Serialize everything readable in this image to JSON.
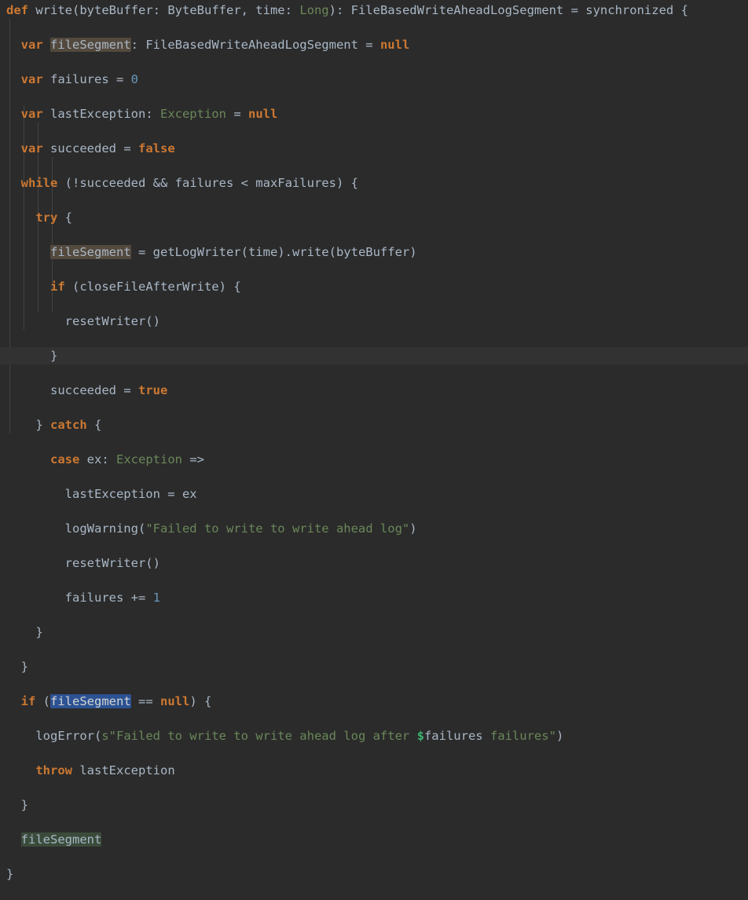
{
  "editor": {
    "language": "scala",
    "theme": "darcula",
    "background_color": "#2b2b2b",
    "default_text_color": "#a9b7c6",
    "keyword_color": "#cc7832",
    "type_color": "#6a8759",
    "string_color": "#6a8759",
    "number_color": "#6897bb",
    "interpolation_color": "#3cb371",
    "selection_color": "#2c5293",
    "current_line_color": "#323232",
    "write_occurrence_color": "#53493d",
    "read_occurrence_color": "#3b4b3b",
    "indent_guide_color": "#4b4b4b",
    "current_line_index": 20,
    "total_lines": 26
  },
  "code": {
    "lines": [
      {
        "index": 1,
        "indent": 0,
        "tokens": [
          {
            "t": "def",
            "c": "kw"
          },
          {
            "t": " ",
            "c": "plain"
          },
          {
            "t": "write",
            "c": "plain"
          },
          {
            "t": "(byteBuffer: ByteBuffer, time: ",
            "c": "plain"
          },
          {
            "t": "Long",
            "c": "type"
          },
          {
            "t": "): FileBasedWriteAheadLogSegment = synchronized {",
            "c": "plain"
          }
        ]
      },
      {
        "index": 2,
        "indent": 1,
        "tokens": [
          {
            "t": "var",
            "c": "kw"
          },
          {
            "t": " ",
            "c": "plain"
          },
          {
            "t": "fileSegment",
            "c": "plain",
            "hl": "occ-write"
          },
          {
            "t": ": FileBasedWriteAheadLogSegment = ",
            "c": "plain"
          },
          {
            "t": "null",
            "c": "kw"
          }
        ]
      },
      {
        "index": 3,
        "indent": 1,
        "tokens": [
          {
            "t": "var",
            "c": "kw"
          },
          {
            "t": " failures = ",
            "c": "plain"
          },
          {
            "t": "0",
            "c": "num"
          }
        ]
      },
      {
        "index": 4,
        "indent": 1,
        "tokens": [
          {
            "t": "var",
            "c": "kw"
          },
          {
            "t": " lastException: ",
            "c": "plain"
          },
          {
            "t": "Exception",
            "c": "type"
          },
          {
            "t": " = ",
            "c": "plain"
          },
          {
            "t": "null",
            "c": "kw"
          }
        ]
      },
      {
        "index": 5,
        "indent": 1,
        "tokens": [
          {
            "t": "var",
            "c": "kw"
          },
          {
            "t": " succeeded = ",
            "c": "plain"
          },
          {
            "t": "false",
            "c": "kw"
          }
        ]
      },
      {
        "index": 6,
        "indent": 1,
        "tokens": [
          {
            "t": "while",
            "c": "kw"
          },
          {
            "t": " (!succeeded && failures < maxFailures) {",
            "c": "plain"
          }
        ]
      },
      {
        "index": 7,
        "indent": 2,
        "tokens": [
          {
            "t": "try",
            "c": "kw"
          },
          {
            "t": " {",
            "c": "plain"
          }
        ]
      },
      {
        "index": 8,
        "indent": 3,
        "tokens": [
          {
            "t": "fileSegment",
            "c": "plain",
            "hl": "occ-write"
          },
          {
            "t": " = getLogWriter(time).write(byteBuffer)",
            "c": "plain"
          }
        ]
      },
      {
        "index": 9,
        "indent": 3,
        "tokens": [
          {
            "t": "if",
            "c": "kw"
          },
          {
            "t": " (closeFileAfterWrite) {",
            "c": "plain"
          }
        ]
      },
      {
        "index": 10,
        "indent": 4,
        "tokens": [
          {
            "t": "resetWriter()",
            "c": "plain"
          }
        ]
      },
      {
        "index": 11,
        "indent": 3,
        "tokens": [
          {
            "t": "}",
            "c": "plain"
          }
        ]
      },
      {
        "index": 12,
        "indent": 3,
        "tokens": [
          {
            "t": "succeeded = ",
            "c": "plain"
          },
          {
            "t": "true",
            "c": "kw"
          }
        ]
      },
      {
        "index": 13,
        "indent": 2,
        "tokens": [
          {
            "t": "} ",
            "c": "plain"
          },
          {
            "t": "catch",
            "c": "kw"
          },
          {
            "t": " {",
            "c": "plain"
          }
        ]
      },
      {
        "index": 14,
        "indent": 3,
        "tokens": [
          {
            "t": "case",
            "c": "kw"
          },
          {
            "t": " ex: ",
            "c": "plain"
          },
          {
            "t": "Exception",
            "c": "type"
          },
          {
            "t": " =>",
            "c": "plain"
          }
        ]
      },
      {
        "index": 15,
        "indent": 4,
        "tokens": [
          {
            "t": "lastException = ex",
            "c": "plain"
          }
        ]
      },
      {
        "index": 16,
        "indent": 4,
        "tokens": [
          {
            "t": "logWarning(",
            "c": "plain"
          },
          {
            "t": "\"Failed to write to write ahead log\"",
            "c": "str"
          },
          {
            "t": ")",
            "c": "plain"
          }
        ]
      },
      {
        "index": 17,
        "indent": 4,
        "tokens": [
          {
            "t": "resetWriter()",
            "c": "plain"
          }
        ]
      },
      {
        "index": 18,
        "indent": 4,
        "tokens": [
          {
            "t": "failures += ",
            "c": "plain"
          },
          {
            "t": "1",
            "c": "num"
          }
        ]
      },
      {
        "index": 19,
        "indent": 2,
        "tokens": [
          {
            "t": "}",
            "c": "plain"
          }
        ]
      },
      {
        "index": 20,
        "indent": 1,
        "tokens": [
          {
            "t": "}",
            "c": "plain"
          }
        ]
      },
      {
        "index": 21,
        "indent": 1,
        "current": true,
        "tokens": [
          {
            "t": "if",
            "c": "kw"
          },
          {
            "t": " (",
            "c": "plain"
          },
          {
            "t": "fileSegment",
            "c": "plain",
            "hl": "sel"
          },
          {
            "t": " == ",
            "c": "plain"
          },
          {
            "t": "null",
            "c": "kw"
          },
          {
            "t": ") {",
            "c": "plain"
          }
        ]
      },
      {
        "index": 22,
        "indent": 2,
        "tokens": [
          {
            "t": "logError(",
            "c": "plain"
          },
          {
            "t": "s\"Failed to write to write ahead log after ",
            "c": "str"
          },
          {
            "t": "$",
            "c": "interp"
          },
          {
            "t": "failures",
            "c": "interpv"
          },
          {
            "t": " failures\"",
            "c": "str"
          },
          {
            "t": ")",
            "c": "plain"
          }
        ]
      },
      {
        "index": 23,
        "indent": 2,
        "tokens": [
          {
            "t": "throw",
            "c": "kw"
          },
          {
            "t": " lastException",
            "c": "plain"
          }
        ]
      },
      {
        "index": 24,
        "indent": 1,
        "tokens": [
          {
            "t": "}",
            "c": "plain"
          }
        ]
      },
      {
        "index": 25,
        "indent": 1,
        "tokens": [
          {
            "t": "fileSegment",
            "c": "plain",
            "hl": "occ-read"
          }
        ]
      },
      {
        "index": 26,
        "indent": 0,
        "tokens": [
          {
            "t": "}",
            "c": "plain"
          }
        ]
      }
    ]
  },
  "indent_guides": [
    {
      "x": 12,
      "from_line": 2,
      "to_line": 25
    },
    {
      "x": 30,
      "from_line": 7,
      "to_line": 19
    },
    {
      "x": 48,
      "from_line": 8,
      "to_line": 18
    },
    {
      "x": 66,
      "from_line": 10,
      "to_line": 18
    }
  ]
}
